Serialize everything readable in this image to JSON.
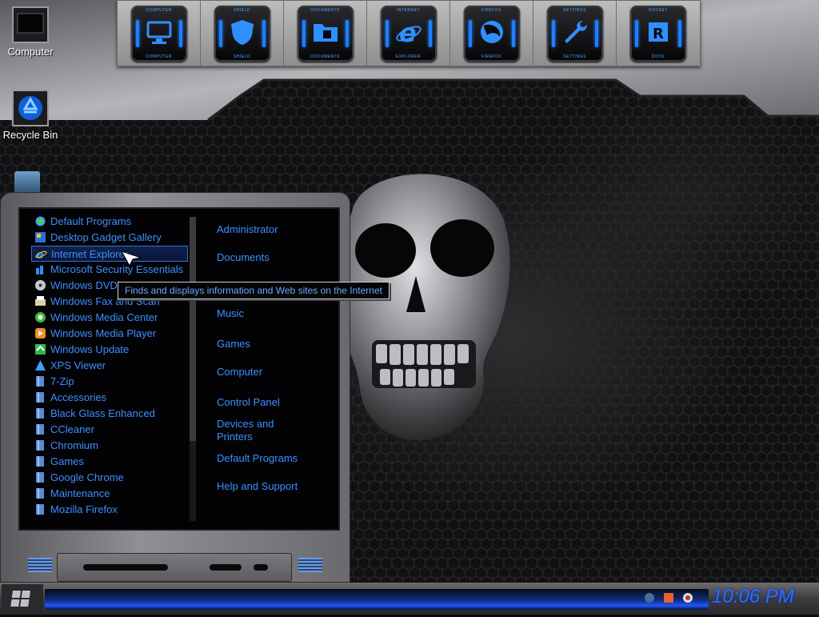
{
  "dock": {
    "items": [
      {
        "top": "COMPUTER",
        "bottom": "COMPUTER",
        "icon": "computer-icon"
      },
      {
        "top": "SHIELD",
        "bottom": "SHIELD",
        "icon": "shield-icon"
      },
      {
        "top": "DOCUMENTS",
        "bottom": "DOCUMENTS",
        "icon": "folder-icon"
      },
      {
        "top": "INTERNET",
        "bottom": "EXPLORER",
        "icon": "internet-explorer-icon"
      },
      {
        "top": "FIREFOX",
        "bottom": "FIREFOX",
        "icon": "firefox-icon"
      },
      {
        "top": "SETTINGS",
        "bottom": "SETTINGS",
        "icon": "wrench-icon"
      },
      {
        "top": "ROCKET",
        "bottom": "DOCK",
        "icon": "rocketdock-icon"
      }
    ]
  },
  "desktop": {
    "computer_label": "Computer",
    "recycle_label": "Recycle Bin"
  },
  "start_menu": {
    "programs": [
      {
        "label": "Default Programs",
        "icon": "default-programs-icon"
      },
      {
        "label": "Desktop Gadget Gallery",
        "icon": "gadget-gallery-icon"
      },
      {
        "label": "Internet Explorer",
        "icon": "internet-explorer-icon",
        "selected": true
      },
      {
        "label": "Microsoft Security Essentials",
        "icon": "security-essentials-icon"
      },
      {
        "label": "Windows DVD",
        "icon": "dvd-maker-icon"
      },
      {
        "label": "Windows Fax and Scan",
        "icon": "fax-scan-icon"
      },
      {
        "label": "Windows Media Center",
        "icon": "media-center-icon"
      },
      {
        "label": "Windows Media Player",
        "icon": "media-player-icon"
      },
      {
        "label": "Windows Update",
        "icon": "windows-update-icon"
      },
      {
        "label": "XPS Viewer",
        "icon": "xps-viewer-icon"
      },
      {
        "label": "7-Zip",
        "icon": "folder-icon"
      },
      {
        "label": "Accessories",
        "icon": "folder-icon"
      },
      {
        "label": "Black Glass Enhanced",
        "icon": "folder-icon"
      },
      {
        "label": "CCleaner",
        "icon": "folder-icon"
      },
      {
        "label": "Chromium",
        "icon": "folder-icon"
      },
      {
        "label": "Games",
        "icon": "folder-icon"
      },
      {
        "label": "Google Chrome",
        "icon": "folder-icon"
      },
      {
        "label": "Maintenance",
        "icon": "folder-icon"
      },
      {
        "label": "Mozilla Firefox",
        "icon": "folder-icon"
      }
    ],
    "right_links": [
      {
        "label": "Administrator"
      },
      {
        "label": "Documents"
      },
      {
        "label": "Music"
      },
      {
        "label": "Games"
      },
      {
        "label": "Computer"
      },
      {
        "label": "Control Panel"
      },
      {
        "label": "Devices and Printers"
      },
      {
        "label": "Default Programs"
      },
      {
        "label": "Help and Support"
      }
    ]
  },
  "tooltip": "Finds and displays information and Web sites on the Internet",
  "taskbar": {
    "clock": "10:06 PM"
  },
  "colors": {
    "accent": "#3d8eff",
    "taskbar_glow": "#1f58ff"
  }
}
